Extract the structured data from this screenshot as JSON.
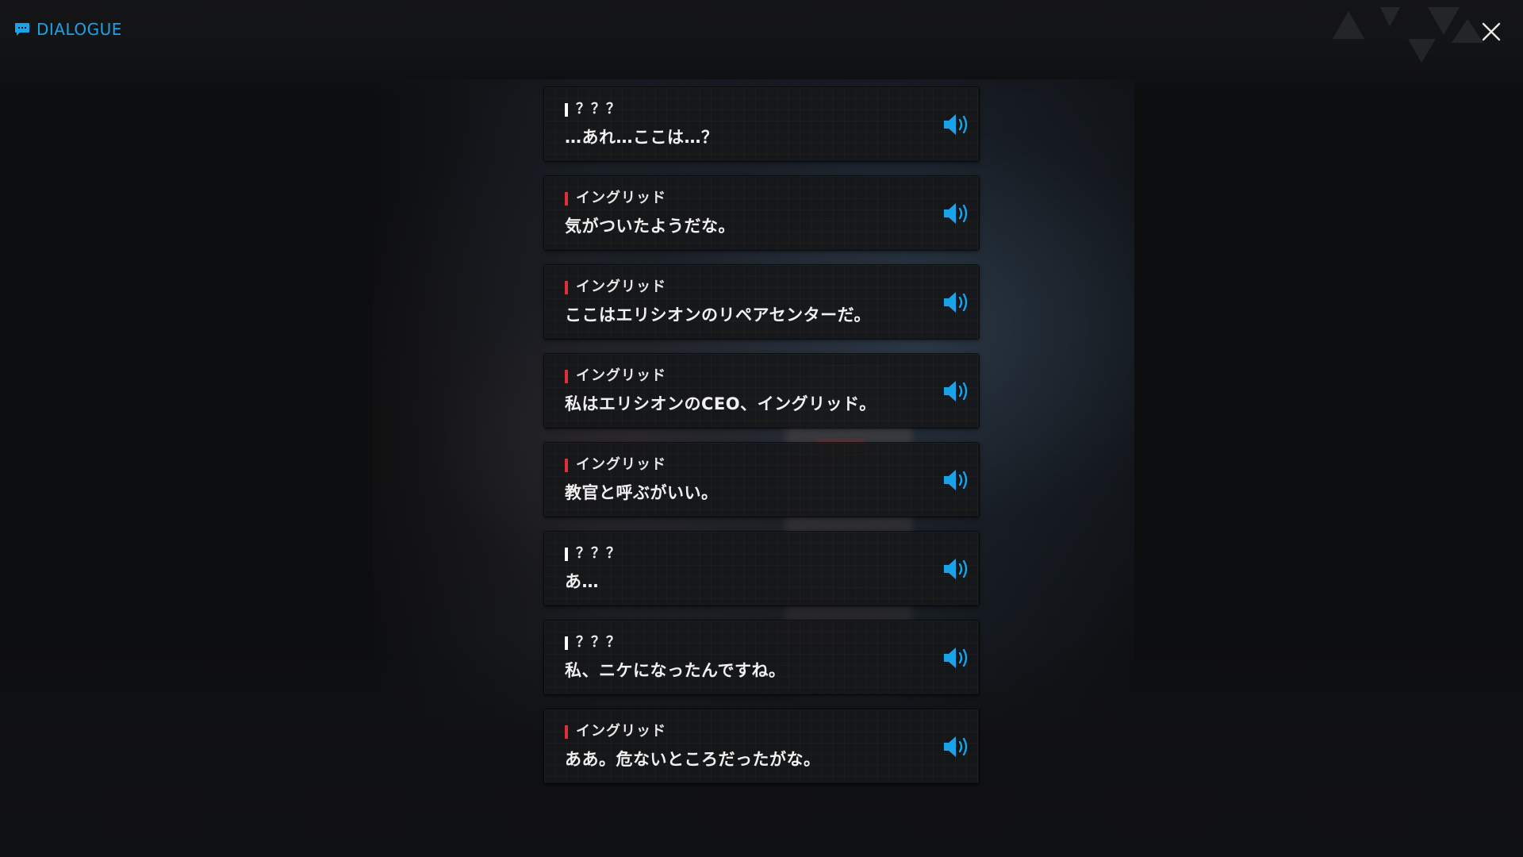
{
  "header": {
    "title": "DIALOGUE",
    "title_icon": "chat-bubble-icon",
    "close_icon": "close-icon"
  },
  "colors": {
    "accent": "#1aa3e8",
    "speaker_named": "#e0303a",
    "speaker_unknown": "#ffffff",
    "background": "#0d0e10"
  },
  "dialogue": [
    {
      "speaker": "？？？",
      "text": "…あれ…ここは…？",
      "named": false,
      "voice_icon": "speaker-icon"
    },
    {
      "speaker": "イングリッド",
      "text": "気がついたようだな。",
      "named": true,
      "voice_icon": "speaker-icon"
    },
    {
      "speaker": "イングリッド",
      "text": "ここはエリシオンのリペアセンターだ。",
      "named": true,
      "voice_icon": "speaker-icon"
    },
    {
      "speaker": "イングリッド",
      "text": "私はエリシオンのCEO、イングリッド。",
      "named": true,
      "voice_icon": "speaker-icon"
    },
    {
      "speaker": "イングリッド",
      "text": "教官と呼ぶがいい。",
      "named": true,
      "voice_icon": "speaker-icon"
    },
    {
      "speaker": "？？？",
      "text": "あ…",
      "named": false,
      "voice_icon": "speaker-icon"
    },
    {
      "speaker": "？？？",
      "text": "私、ニケになったんですね。",
      "named": false,
      "voice_icon": "speaker-icon"
    },
    {
      "speaker": "イングリッド",
      "text": "ああ。危ないところだったがな。",
      "named": true,
      "voice_icon": "speaker-icon"
    }
  ]
}
